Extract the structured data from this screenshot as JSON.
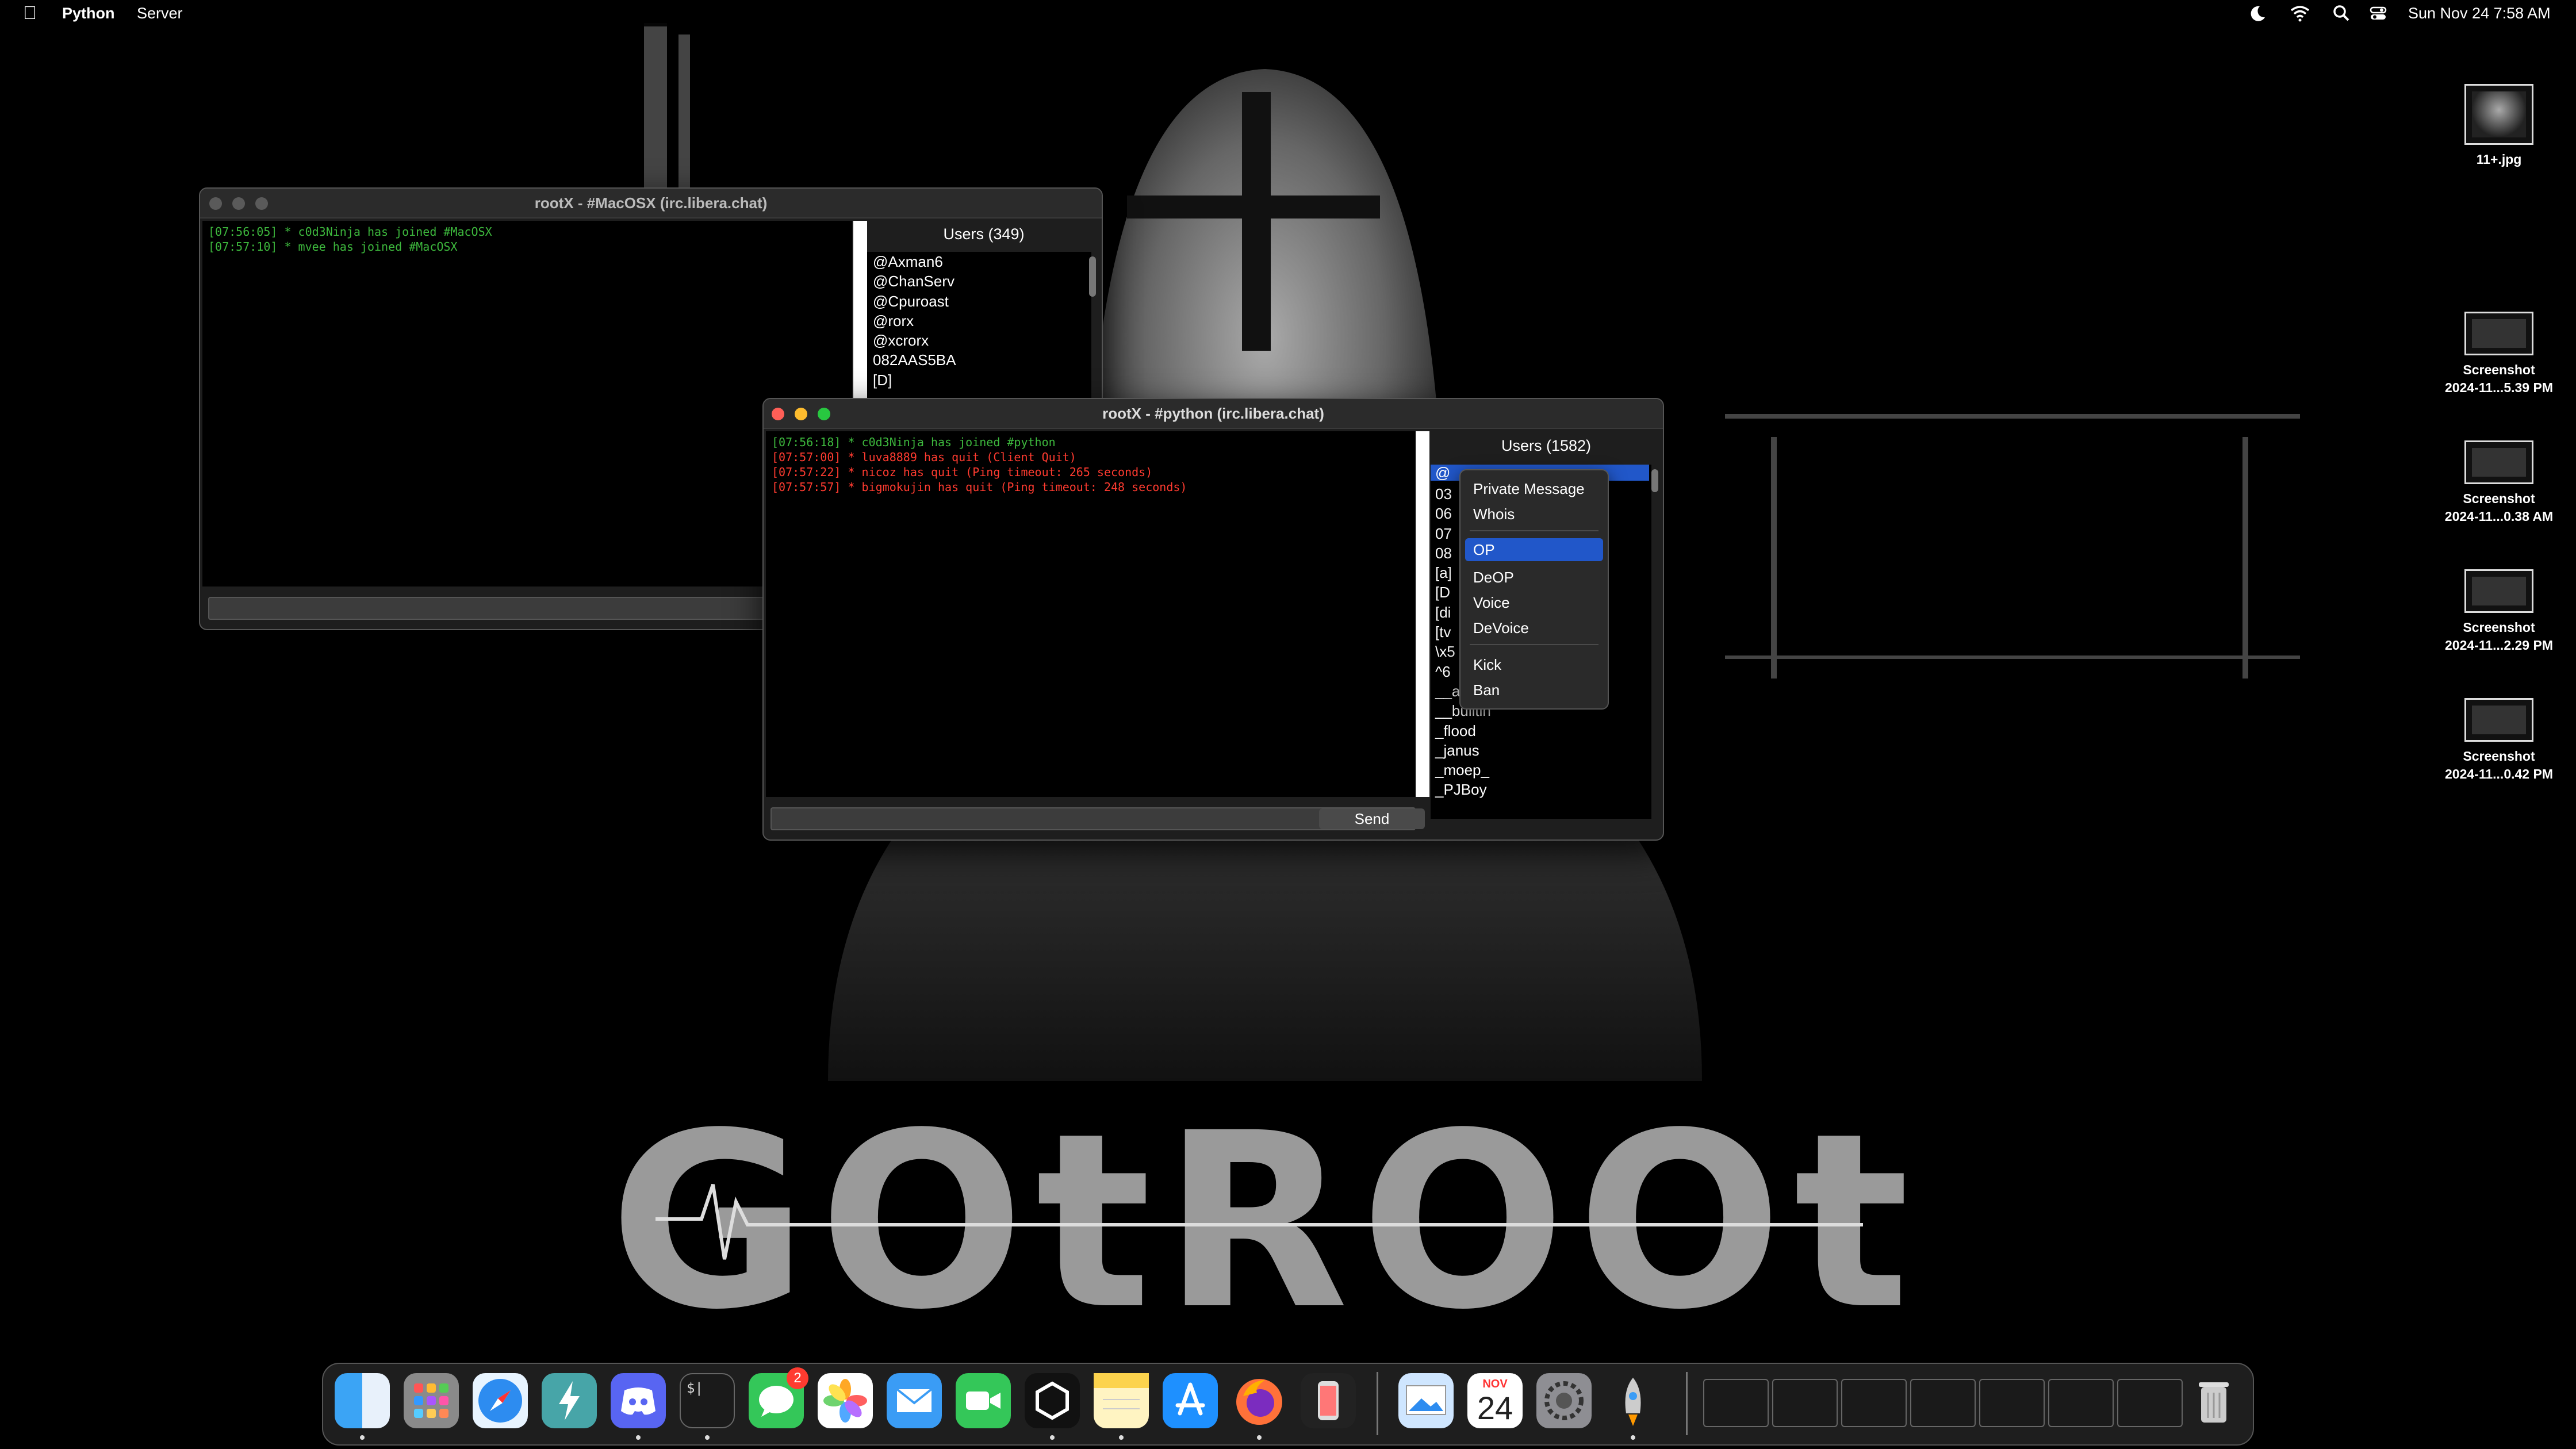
{
  "menubar": {
    "apple": "",
    "app_name": "Python",
    "menus": [
      "Server"
    ],
    "clock": "Sun Nov 24  7:58 AM",
    "status_icons": [
      "dark-mode-icon",
      "wifi-icon",
      "spotlight-icon",
      "control-center-icon"
    ]
  },
  "desktop": {
    "items": [
      {
        "label_lines": [
          "11+.jpg"
        ]
      },
      {
        "label_lines": [
          "Screenshot",
          "2024-11...5.39 PM"
        ]
      },
      {
        "label_lines": [
          "Screenshot",
          "2024-11...0.38 AM"
        ]
      },
      {
        "label_lines": [
          "Screenshot",
          "2024-11...2.29 PM"
        ]
      },
      {
        "label_lines": [
          "Screenshot",
          "2024-11...0.42 PM"
        ]
      }
    ],
    "wallpaper_text": "GOtROOt"
  },
  "window_macosx": {
    "title": "rootX - #MacOSX (irc.libera.chat)",
    "log": [
      {
        "text": "[07:56:05] * c0d3Ninja has joined #MacOSX",
        "color": "#3db83d"
      },
      {
        "text": "[07:57:10] * mvee has joined #MacOSX",
        "color": "#3db83d"
      }
    ],
    "users_title": "Users (349)",
    "users": [
      "@Axman6",
      "@ChanServ",
      "@Cpuroast",
      "@rorx",
      "@xcrorx",
      "082AAS5BA",
      "[D]"
    ]
  },
  "window_python": {
    "title": "rootX - #python (irc.libera.chat)",
    "log": [
      {
        "text": "[07:56:18] * c0d3Ninja has joined #python",
        "color": "#3db83d"
      },
      {
        "text": "[07:57:00] * luva8889 has quit (Client Quit)",
        "color": "#ff3b30"
      },
      {
        "text": "[07:57:22] * nicoz has quit (Ping timeout: 265 seconds)",
        "color": "#ff3b30"
      },
      {
        "text": "[07:57:57] * bigmokujin has quit (Ping timeout: 248 seconds)",
        "color": "#ff3b30"
      }
    ],
    "users_title": "Users (1582)",
    "users": [
      "@",
      "03",
      "06",
      "07",
      "08",
      "[a]",
      "[D",
      "[di",
      "[tv",
      "\\x5",
      "^6",
      "__au",
      "__builtin",
      "_flood",
      "_janus",
      "_moep_",
      "_PJBoy"
    ],
    "send_label": "Send",
    "input_value": ""
  },
  "context_menu": {
    "items": [
      "Private Message",
      "Whois",
      "OP",
      "DeOP",
      "Voice",
      "DeVoice",
      "Kick",
      "Ban"
    ],
    "selected": "OP"
  },
  "dock": {
    "apps": [
      "finder-icon",
      "launchpad-icon",
      "safari-icon",
      "electron-icon",
      "discord-icon",
      "terminal-icon",
      "messages-icon",
      "photos-icon",
      "mail-icon",
      "facetime-icon",
      "unity-icon",
      "notes-icon",
      "app-store-icon",
      "firefox-icon",
      "iphone-mirroring-icon",
      "preview-icon",
      "calendar-icon",
      "system-settings-icon",
      "rocket-icon",
      "trash-icon"
    ],
    "messages_badge": "2",
    "calendar_month": "NOV",
    "calendar_day": "24",
    "terminal_glyph": "$|"
  },
  "colors": {
    "selection": "#2157c9",
    "join": "#3db83d",
    "quit": "#ff3b30"
  }
}
